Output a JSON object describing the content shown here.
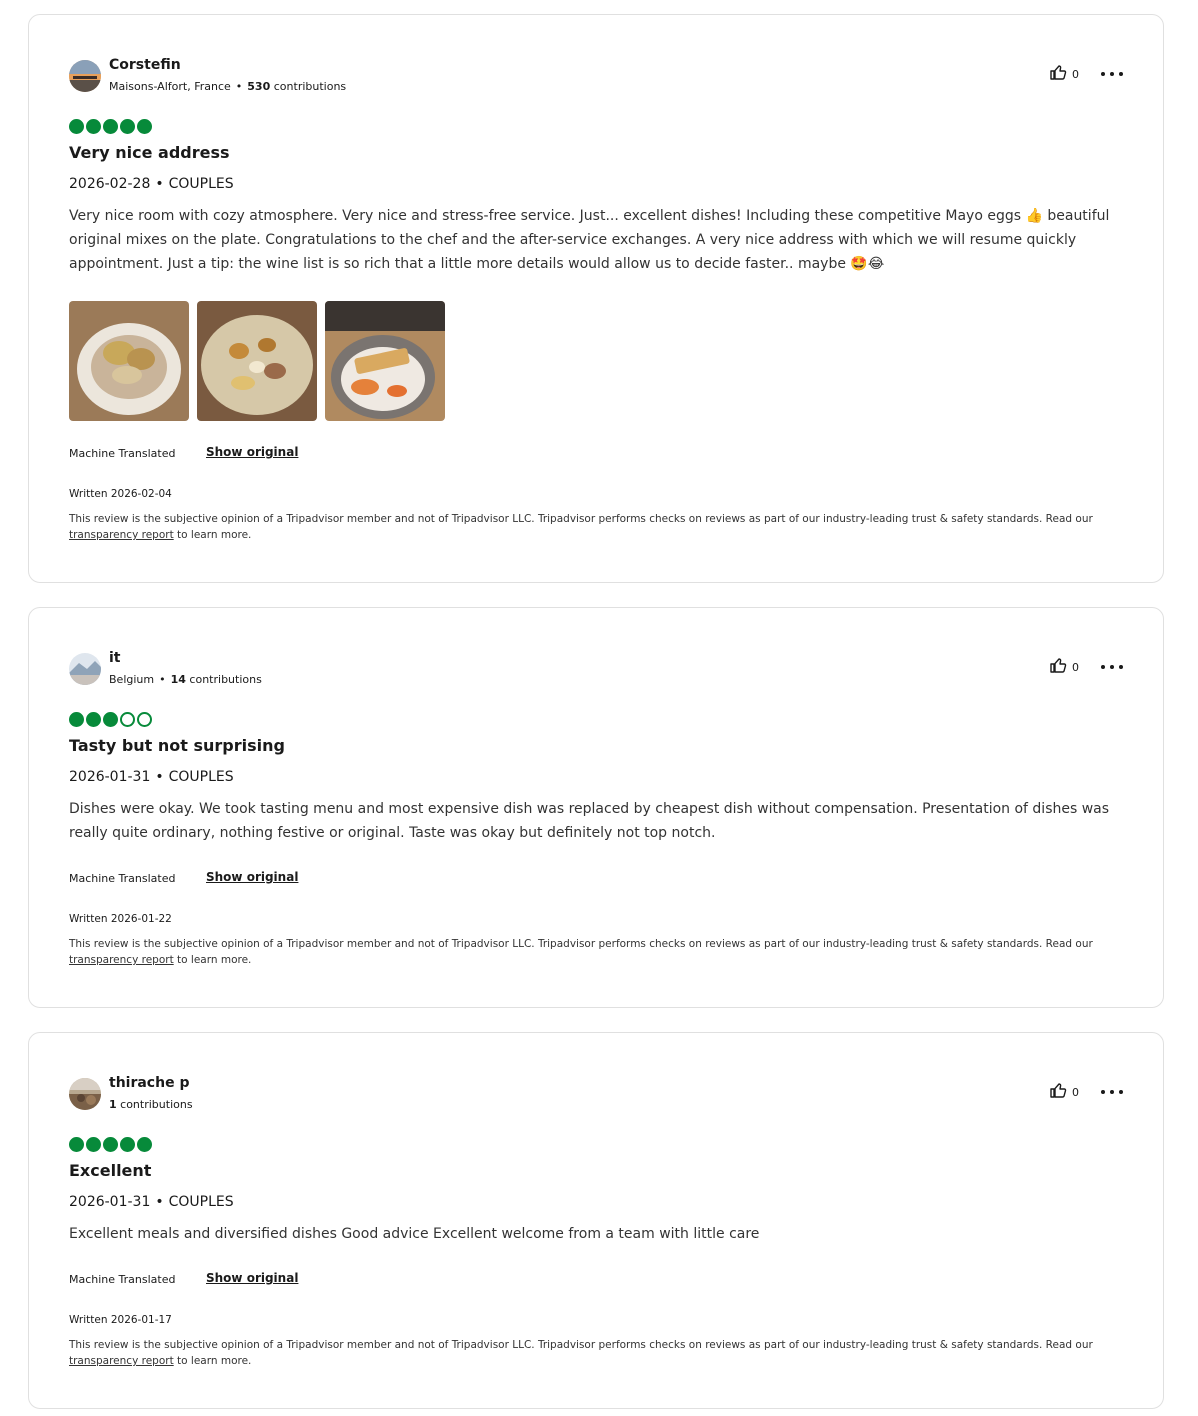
{
  "reviews": [
    {
      "user": {
        "name": "Corstefin",
        "location": "Maisons-Alfort, France",
        "contrib_count": "530",
        "contrib_label": "contributions"
      },
      "helpful_count": "0",
      "rating": 5,
      "title": "Very nice address",
      "date": "2026-02-28",
      "trip_type": "COUPLES",
      "text": "Very nice room with cozy atmosphere. Very nice and stress-free service. Just... excellent dishes! Including these competitive Mayo eggs 👍 beautiful original mixes on the plate. Congratulations to the chef and the after-service exchanges. A very nice address with which we will resume quickly appointment. Just a tip: the wine list is so rich that a little more details would allow us to decide faster.. maybe 🤩😂",
      "machine_translated": "Machine Translated",
      "show_original": "Show original",
      "written": "Written 2026-02-04",
      "disclaimer_pre": "This review is the subjective opinion of a Tripadvisor member and not of Tripadvisor LLC. Tripadvisor performs checks on reviews as part of our industry-leading trust & safety standards. Read our",
      "disclaimer_link": "transparency report",
      "disclaimer_post": "to learn more."
    },
    {
      "user": {
        "name": "it",
        "location": "Belgium",
        "contrib_count": "14",
        "contrib_label": "contributions"
      },
      "helpful_count": "0",
      "rating": 3,
      "title": "Tasty but not surprising",
      "date": "2026-01-31",
      "trip_type": "COUPLES",
      "text": "Dishes were okay. We took tasting menu and most expensive dish was replaced by cheapest dish without compensation. Presentation of dishes was really quite ordinary, nothing festive or original. Taste was okay but definitely not top notch.",
      "machine_translated": "Machine Translated",
      "show_original": "Show original",
      "written": "Written 2026-01-22",
      "disclaimer_pre": "This review is the subjective opinion of a Tripadvisor member and not of Tripadvisor LLC. Tripadvisor performs checks on reviews as part of our industry-leading trust & safety standards. Read our",
      "disclaimer_link": "transparency report",
      "disclaimer_post": "to learn more."
    },
    {
      "user": {
        "name": "thirache p",
        "location": "",
        "contrib_count": "1",
        "contrib_label": "contributions"
      },
      "helpful_count": "0",
      "rating": 5,
      "title": "Excellent",
      "date": "2026-01-31",
      "trip_type": "COUPLES",
      "text": "Excellent meals and diversified dishes Good advice Excellent welcome from a team with little care",
      "machine_translated": "Machine Translated",
      "show_original": "Show original",
      "written": "Written 2026-01-17",
      "disclaimer_pre": "This review is the subjective opinion of a Tripadvisor member and not of Tripadvisor LLC. Tripadvisor performs checks on reviews as part of our industry-leading trust & safety standards. Read our",
      "disclaimer_link": "transparency report",
      "disclaimer_post": "to learn more."
    }
  ],
  "colors": {
    "bubble": "#078a3a",
    "border": "#e0e0e0",
    "text": "#1a1a1a"
  },
  "icons": {
    "helpful": "thumbs-up-icon",
    "more": "more-options-icon"
  }
}
